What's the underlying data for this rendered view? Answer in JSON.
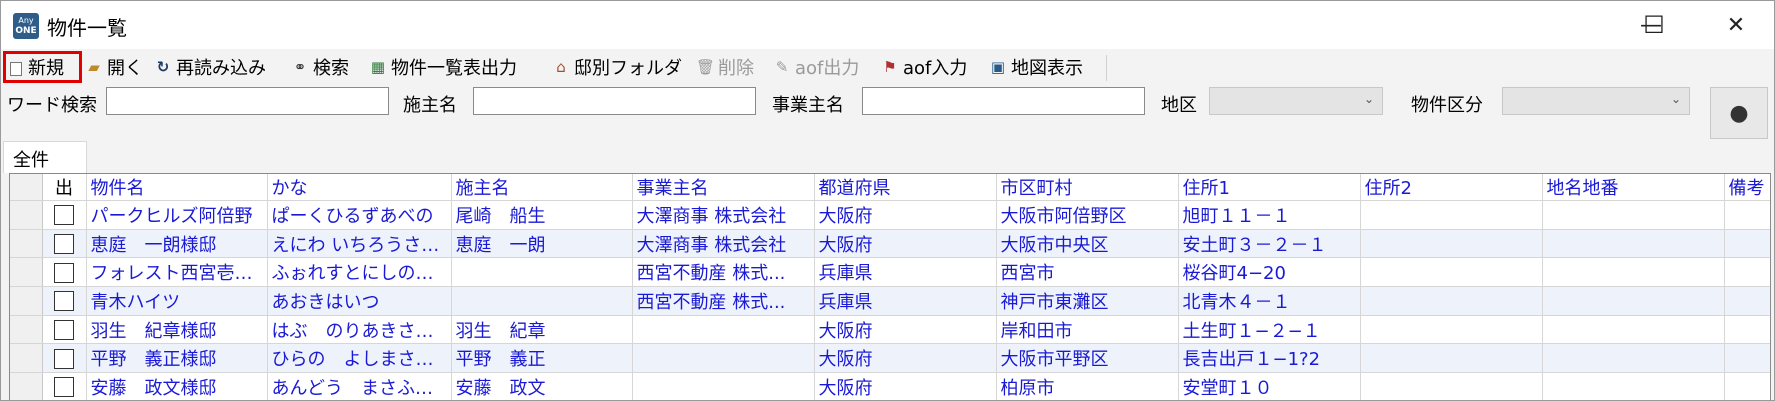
{
  "window": {
    "title": "物件一覧",
    "icon_text_top": "Any",
    "icon_text_bottom": "ONE",
    "minimize": "—",
    "maximize": "☐",
    "close": "✕"
  },
  "toolbar": {
    "new": "新規",
    "open": "開く",
    "reload": "再読み込み",
    "search": "検索",
    "export_list": "物件一覧表出力",
    "house_folder": "邸別フォルダ",
    "delete": "削除",
    "aof_out": "aof出力",
    "aof_in": "aof入力",
    "map": "地図表示"
  },
  "filters": {
    "word_label": "ワード検索",
    "word_value": "",
    "owner_label": "施主名",
    "owner_value": "",
    "business_label": "事業主名",
    "business_value": "",
    "area_label": "地区",
    "area_value": "",
    "category_label": "物件区分",
    "category_value": ""
  },
  "tabs": [
    {
      "label": "全件"
    }
  ],
  "table": {
    "columns": [
      "出",
      "物件名",
      "かな",
      "施主名",
      "事業主名",
      "都道府県",
      "市区町村",
      "住所1",
      "住所2",
      "地名地番",
      "備考"
    ],
    "rows": [
      {
        "name": "パークヒルズ阿倍野",
        "kana": "ぱーくひるずあべの",
        "owner": "尾崎　船生",
        "business": "大澤商事 株式会社",
        "pref": "大阪府",
        "city": "大阪市阿倍野区",
        "addr1": "旭町１１－１",
        "addr2": "",
        "lot": ""
      },
      {
        "name": "恵庭　一朗様邸",
        "kana": "えにわ いちろうさま...",
        "owner": "恵庭　一朗",
        "business": "大澤商事 株式会社",
        "pref": "大阪府",
        "city": "大阪市中央区",
        "addr1": "安土町３－２－１",
        "addr2": "",
        "lot": ""
      },
      {
        "name": "フォレスト西宮壱番...",
        "kana": "ふぉれすとにしのみ...",
        "owner": "",
        "business": "西宮不動産 株式...",
        "pref": "兵庫県",
        "city": "西宮市",
        "addr1": "桜谷町4−20",
        "addr2": "",
        "lot": ""
      },
      {
        "name": "青木ハイツ",
        "kana": "あおきはいつ",
        "owner": "",
        "business": "西宮不動産 株式...",
        "pref": "兵庫県",
        "city": "神戸市東灘区",
        "addr1": "北青木４－１",
        "addr2": "",
        "lot": ""
      },
      {
        "name": "羽生　紀章様邸",
        "kana": "はぶ　のりあきさまて...",
        "owner": "羽生　紀章",
        "business": "",
        "pref": "大阪府",
        "city": "岸和田市",
        "addr1": "土生町１−２−１",
        "addr2": "",
        "lot": ""
      },
      {
        "name": "平野　義正様邸",
        "kana": "ひらの　よしまささま...",
        "owner": "平野　義正",
        "business": "",
        "pref": "大阪府",
        "city": "大阪市平野区",
        "addr1": "長吉出戸１−1?2",
        "addr2": "",
        "lot": ""
      },
      {
        "name": "安藤　政文様邸",
        "kana": "あんどう　まさふみさ...",
        "owner": "安藤　政文",
        "business": "",
        "pref": "大阪府",
        "city": "柏原市",
        "addr1": "安堂町１０",
        "addr2": "",
        "lot": ""
      }
    ]
  },
  "colors": {
    "link_text": "#1a1ad6",
    "highlight_border": "#e00000",
    "alt_row": "#eef3fb"
  }
}
